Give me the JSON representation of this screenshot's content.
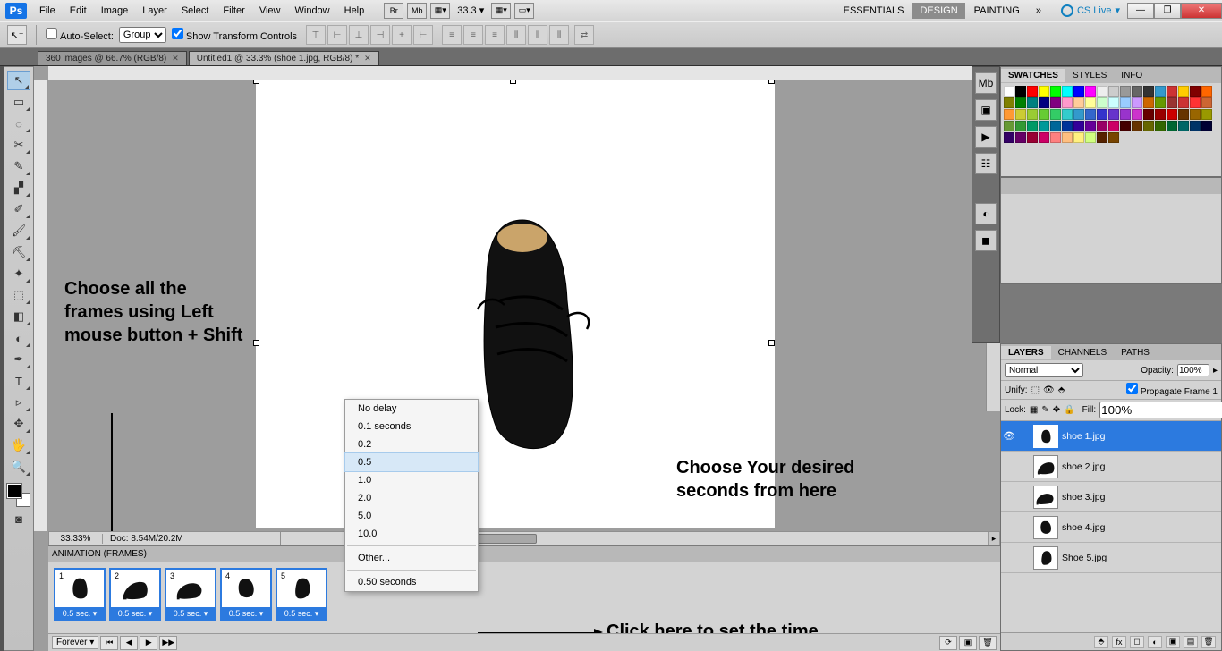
{
  "menubar": {
    "items": [
      "File",
      "Edit",
      "Image",
      "Layer",
      "Select",
      "Filter",
      "View",
      "Window",
      "Help"
    ],
    "zoom_display": "33.3",
    "workspace_tabs": [
      "ESSENTIALS",
      "DESIGN",
      "PAINTING"
    ],
    "workspace_active": 1,
    "more_glyph": "»",
    "cslive": "CS Live"
  },
  "optionsbar": {
    "auto_select_label": "Auto-Select:",
    "auto_select_mode": "Group",
    "show_transform": "Show Transform Controls"
  },
  "tabs": [
    {
      "label": "360 images @ 66.7% (RGB/8)",
      "active": false
    },
    {
      "label": "Untitled1 @ 33.3% (shoe 1.jpg, RGB/8) *",
      "active": true
    }
  ],
  "status": {
    "zoom": "33.33%",
    "doc": "Doc: 8.54M/20.2M"
  },
  "annotations": {
    "left": "Choose all the frames using Left mouse button + Shift",
    "right": "Choose Your desired seconds from here",
    "bottom": "Click here to set the time"
  },
  "context_menu": {
    "items": [
      "No delay",
      "0.1 seconds",
      "0.2",
      "0.5",
      "1.0",
      "2.0",
      "5.0",
      "10.0"
    ],
    "selected_index": 3,
    "other_label": "Other...",
    "current_label": "0.50 seconds"
  },
  "animation": {
    "title": "ANIMATION (FRAMES)",
    "frames": [
      {
        "n": "1",
        "time": "0.5 sec."
      },
      {
        "n": "2",
        "time": "0.5 sec."
      },
      {
        "n": "3",
        "time": "0.5 sec."
      },
      {
        "n": "4",
        "time": "0.5 sec."
      },
      {
        "n": "5",
        "time": "0.5 sec."
      }
    ],
    "loop": "Forever"
  },
  "swatches_panel": {
    "tabs": [
      "SWATCHES",
      "STYLES",
      "INFO"
    ],
    "active": 0
  },
  "swatch_colors": [
    "#ffffff",
    "#000000",
    "#ff0000",
    "#ffff00",
    "#00ff00",
    "#00ffff",
    "#0000ff",
    "#ff00ff",
    "#eeeeee",
    "#cccccc",
    "#999999",
    "#666666",
    "#333333",
    "#39c",
    "#c33",
    "#fc0",
    "#800000",
    "#ff6600",
    "#808000",
    "#008000",
    "#008080",
    "#000080",
    "#800080",
    "#ff99cc",
    "#ffcc99",
    "#ffff99",
    "#ccffcc",
    "#ccffff",
    "#99ccff",
    "#cc99ff",
    "#cc6600",
    "#669900",
    "#993333",
    "#cc3333",
    "#ff3333",
    "#cc6633",
    "#ff9933",
    "#cccc33",
    "#99cc33",
    "#66cc33",
    "#33cc66",
    "#33cccc",
    "#3399cc",
    "#3366cc",
    "#3333cc",
    "#6633cc",
    "#9933cc",
    "#cc33cc",
    "#660000",
    "#990000",
    "#cc0000",
    "#663300",
    "#996600",
    "#999900",
    "#669933",
    "#339933",
    "#009966",
    "#009999",
    "#006699",
    "#003399",
    "#330099",
    "#660099",
    "#990066",
    "#cc0066",
    "#400",
    "#630",
    "#660",
    "#360",
    "#063",
    "#066",
    "#036",
    "#003",
    "#306",
    "#606",
    "#903",
    "#c06",
    "#ff8080",
    "#ffbf80",
    "#fff080",
    "#d0ff80",
    "#552200",
    "#774400"
  ],
  "layers_panel": {
    "tabs": [
      "LAYERS",
      "CHANNELS",
      "PATHS"
    ],
    "active": 0,
    "blend": "Normal",
    "opacity_label": "Opacity:",
    "opacity": "100%",
    "unify_label": "Unify:",
    "propagate": "Propagate Frame 1",
    "lock_label": "Lock:",
    "fill_label": "Fill:",
    "fill": "100%",
    "layers": [
      {
        "name": "shoe 1.jpg",
        "selected": true,
        "visible": true
      },
      {
        "name": "shoe 2.jpg",
        "selected": false,
        "visible": false
      },
      {
        "name": "shoe 3.jpg",
        "selected": false,
        "visible": false
      },
      {
        "name": "shoe 4.jpg",
        "selected": false,
        "visible": false
      },
      {
        "name": "Shoe 5.jpg",
        "selected": false,
        "visible": false
      }
    ]
  },
  "toolbox_icons": [
    "↖",
    "▭",
    "◌",
    "✂",
    "✎",
    "▞",
    "✐",
    "🖌",
    "⛏",
    "✦",
    "⬚",
    "◧",
    "◐",
    "✒",
    "T",
    "▹",
    "✥",
    "🖐",
    "🔍"
  ]
}
